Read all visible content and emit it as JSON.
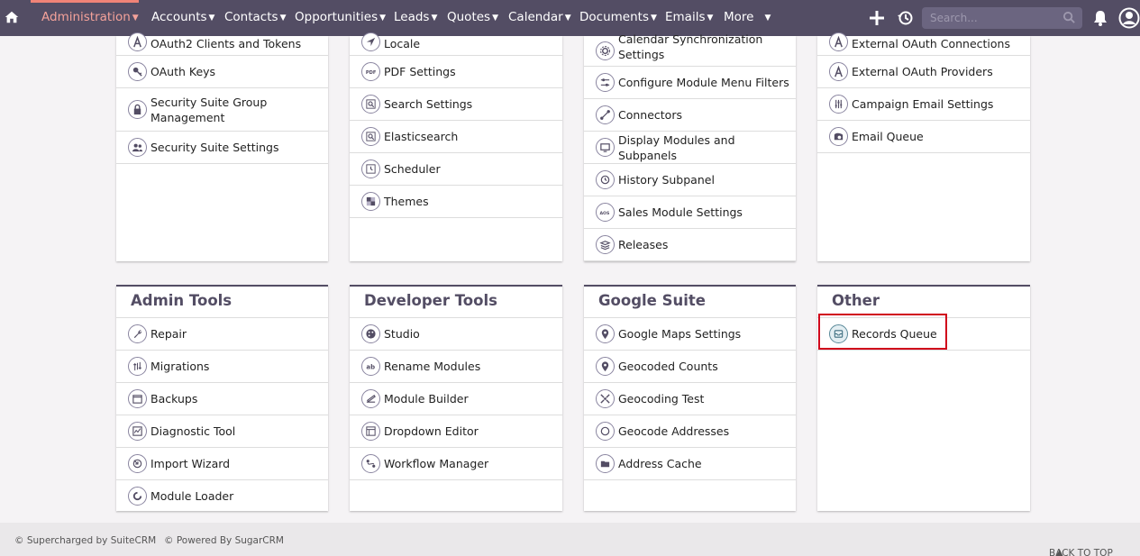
{
  "nav": {
    "items": [
      {
        "label": "Administration",
        "active": true
      },
      {
        "label": "Accounts"
      },
      {
        "label": "Contacts"
      },
      {
        "label": "Opportunities"
      },
      {
        "label": "Leads"
      },
      {
        "label": "Quotes"
      },
      {
        "label": "Calendar"
      },
      {
        "label": "Documents"
      },
      {
        "label": "Emails"
      },
      {
        "label": "More"
      }
    ],
    "search_placeholder": "Search...",
    "accent_color": "#f08377",
    "bar_color": "#534d64"
  },
  "panels": {
    "users_security": {
      "rows": [
        "OAuth2 Clients and Tokens",
        "OAuth Keys",
        "Security Suite Group Management",
        "Security Suite Settings"
      ]
    },
    "system": {
      "rows": [
        "Locale",
        "PDF Settings",
        "Search Settings",
        "Elasticsearch",
        "Scheduler",
        "Themes"
      ]
    },
    "module_settings": {
      "rows": [
        "Calendar Synchronization Settings",
        "Configure Module Menu Filters",
        "Connectors",
        "Display Modules and Subpanels",
        "History Subpanel",
        "Sales Module Settings",
        "Releases"
      ]
    },
    "email": {
      "rows": [
        "External OAuth Connections",
        "External OAuth Providers",
        "Campaign Email Settings",
        "Email Queue"
      ]
    },
    "admin_tools": {
      "title": "Admin Tools",
      "rows": [
        "Repair",
        "Migrations",
        "Backups",
        "Diagnostic Tool",
        "Import Wizard",
        "Module Loader"
      ]
    },
    "developer_tools": {
      "title": "Developer Tools",
      "rows": [
        "Studio",
        "Rename Modules",
        "Module Builder",
        "Dropdown Editor",
        "Workflow Manager"
      ]
    },
    "google_suite": {
      "title": "Google Suite",
      "rows": [
        "Google Maps Settings",
        "Geocoded Counts",
        "Geocoding Test",
        "Geocode Addresses",
        "Address Cache"
      ]
    },
    "other": {
      "title": "Other",
      "rows": [
        "Records Queue"
      ]
    }
  },
  "footer": {
    "supercharged": "© Supercharged by SuiteCRM",
    "powered": "© Powered By SugarCRM",
    "back_to_top": "BACK TO TOP"
  }
}
